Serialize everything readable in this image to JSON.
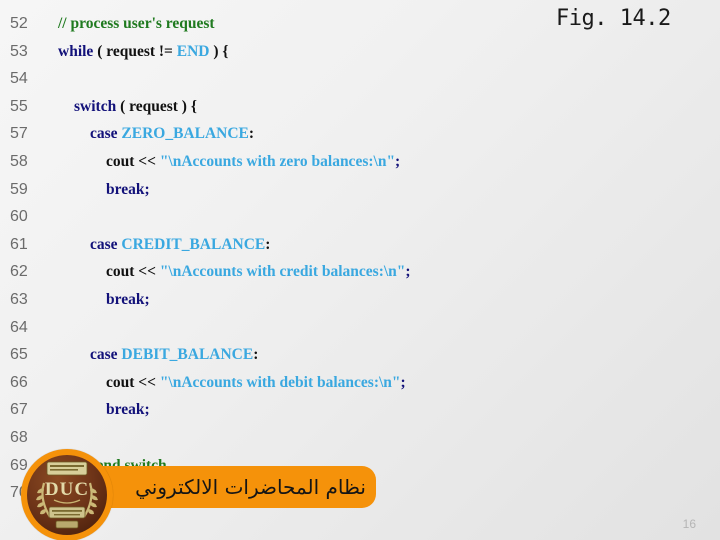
{
  "slide": {
    "figure_label": "Fig. 14.2",
    "page_number": "16",
    "background_from": "#f6f6f6",
    "background_to": "#e2e2e2"
  },
  "code": {
    "language": "cpp",
    "lines": [
      {
        "number": "52",
        "indent": 1,
        "tokens": [
          {
            "text": "// process user's request",
            "type": "comment"
          }
        ]
      },
      {
        "number": "53",
        "indent": 1,
        "tokens": [
          {
            "text": "while",
            "type": "keyword"
          },
          {
            "text": " ( request != ",
            "type": "plain"
          },
          {
            "text": "END",
            "type": "const"
          },
          {
            "text": " ) {",
            "type": "plain"
          }
        ]
      },
      {
        "number": "54",
        "indent": 0,
        "tokens": [
          {
            "text": "",
            "type": "plain"
          }
        ]
      },
      {
        "number": "55",
        "indent": 2,
        "tokens": [
          {
            "text": "switch",
            "type": "keyword"
          },
          {
            "text": " ( request ) {",
            "type": "plain"
          }
        ]
      },
      {
        "number": "57",
        "indent": 3,
        "tokens": [
          {
            "text": "case",
            "type": "keyword"
          },
          {
            "text": " ",
            "type": "plain"
          },
          {
            "text": "ZERO_BALANCE",
            "type": "const"
          },
          {
            "text": ":",
            "type": "plain"
          }
        ]
      },
      {
        "number": "58",
        "indent": 4,
        "tokens": [
          {
            "text": "cout << ",
            "type": "plain"
          },
          {
            "text": "\"\\nAccounts with zero balances:\\n\"",
            "type": "string"
          },
          {
            "text": ";",
            "type": "punct"
          }
        ]
      },
      {
        "number": "59",
        "indent": 4,
        "tokens": [
          {
            "text": "break",
            "type": "keyword"
          },
          {
            "text": ";",
            "type": "punct"
          }
        ]
      },
      {
        "number": "60",
        "indent": 0,
        "tokens": [
          {
            "text": "",
            "type": "plain"
          }
        ]
      },
      {
        "number": "61",
        "indent": 3,
        "tokens": [
          {
            "text": "case",
            "type": "keyword"
          },
          {
            "text": " ",
            "type": "plain"
          },
          {
            "text": "CREDIT_BALANCE",
            "type": "const"
          },
          {
            "text": ":",
            "type": "plain"
          }
        ]
      },
      {
        "number": "62",
        "indent": 4,
        "tokens": [
          {
            "text": "cout << ",
            "type": "plain"
          },
          {
            "text": "\"\\nAccounts with credit balances:\\n\"",
            "type": "string"
          },
          {
            "text": ";",
            "type": "punct"
          }
        ]
      },
      {
        "number": "63",
        "indent": 4,
        "tokens": [
          {
            "text": "break",
            "type": "keyword"
          },
          {
            "text": ";",
            "type": "punct"
          }
        ]
      },
      {
        "number": "64",
        "indent": 0,
        "tokens": [
          {
            "text": "",
            "type": "plain"
          }
        ]
      },
      {
        "number": "65",
        "indent": 3,
        "tokens": [
          {
            "text": "case",
            "type": "keyword"
          },
          {
            "text": " ",
            "type": "plain"
          },
          {
            "text": "DEBIT_BALANCE",
            "type": "const"
          },
          {
            "text": ":",
            "type": "plain"
          }
        ]
      },
      {
        "number": "66",
        "indent": 4,
        "tokens": [
          {
            "text": "cout << ",
            "type": "plain"
          },
          {
            "text": "\"\\nAccounts with debit balances:\\n\"",
            "type": "string"
          },
          {
            "text": ";",
            "type": "punct"
          }
        ]
      },
      {
        "number": "67",
        "indent": 4,
        "tokens": [
          {
            "text": "break",
            "type": "keyword"
          },
          {
            "text": ";",
            "type": "punct"
          }
        ]
      },
      {
        "number": "68",
        "indent": 0,
        "tokens": [
          {
            "text": "",
            "type": "plain"
          }
        ]
      },
      {
        "number": "69",
        "indent": 2,
        "tokens": [
          {
            "text": "} ",
            "type": "plain"
          },
          {
            "text": "// end switch",
            "type": "comment"
          }
        ]
      },
      {
        "number": "70",
        "indent": 0,
        "tokens": [
          {
            "text": "",
            "type": "plain"
          }
        ]
      }
    ]
  },
  "footer": {
    "banner_text": "نظام المحاضرات الالكتروني",
    "banner_color": "#F5920A",
    "logo_ring_color": "#F5920A",
    "logo_body_color": "#6e3418",
    "logo_monogram": "DUC"
  }
}
